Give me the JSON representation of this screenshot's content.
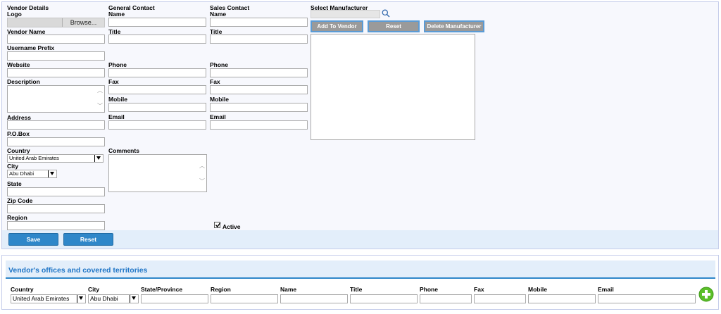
{
  "vendor": {
    "section_title": "Vendor Details",
    "logo_label": "Logo",
    "browse_label": "Browse...",
    "name_label": "Vendor Name",
    "name_value": "",
    "username_prefix_label": "Username Prefix",
    "website_label": "Website",
    "description_label": "Description",
    "address_label": "Address",
    "pobox_label": "P.O.Box",
    "country_label": "Country",
    "country_value": "United Arab Emirates",
    "city_label": "City",
    "city_value": "Abu Dhabi",
    "state_label": "State",
    "zip_label": "Zip Code",
    "region_label": "Region"
  },
  "general_contact": {
    "section_title": "General Contact",
    "name_label": "Name",
    "title_label": "Title",
    "phone_label": "Phone",
    "fax_label": "Fax",
    "mobile_label": "Mobile",
    "email_label": "Email",
    "comments_label": "Comments"
  },
  "sales_contact": {
    "section_title": "Sales Contact",
    "name_label": "Name",
    "title_label": "Title",
    "phone_label": "Phone",
    "fax_label": "Fax",
    "mobile_label": "Mobile",
    "email_label": "Email"
  },
  "manufacturer": {
    "section_title": "Select Manufacturer",
    "search_value": "",
    "add_label": "Add To Vendor",
    "reset_label": "Reset",
    "delete_label": "Delete Manufacturer"
  },
  "active": {
    "label": "Active",
    "checked": true
  },
  "actions": {
    "save_label": "Save",
    "reset_label": "Reset"
  },
  "offices": {
    "title": "Vendor's offices and covered territories",
    "columns": {
      "country": "Country",
      "city": "City",
      "state": "State/Province",
      "region": "Region",
      "name": "Name",
      "title": "Title",
      "phone": "Phone",
      "fax": "Fax",
      "mobile": "Mobile",
      "email": "Email"
    },
    "country_value": "United Arab Emirates",
    "city_value": "Abu Dhabi"
  },
  "colors": {
    "accent": "#2f87c9",
    "header_text": "#1f75c6",
    "panel_bg": "#f7f8fd",
    "panel_border": "#c5cdea",
    "add_button": "#5cbf2a"
  }
}
